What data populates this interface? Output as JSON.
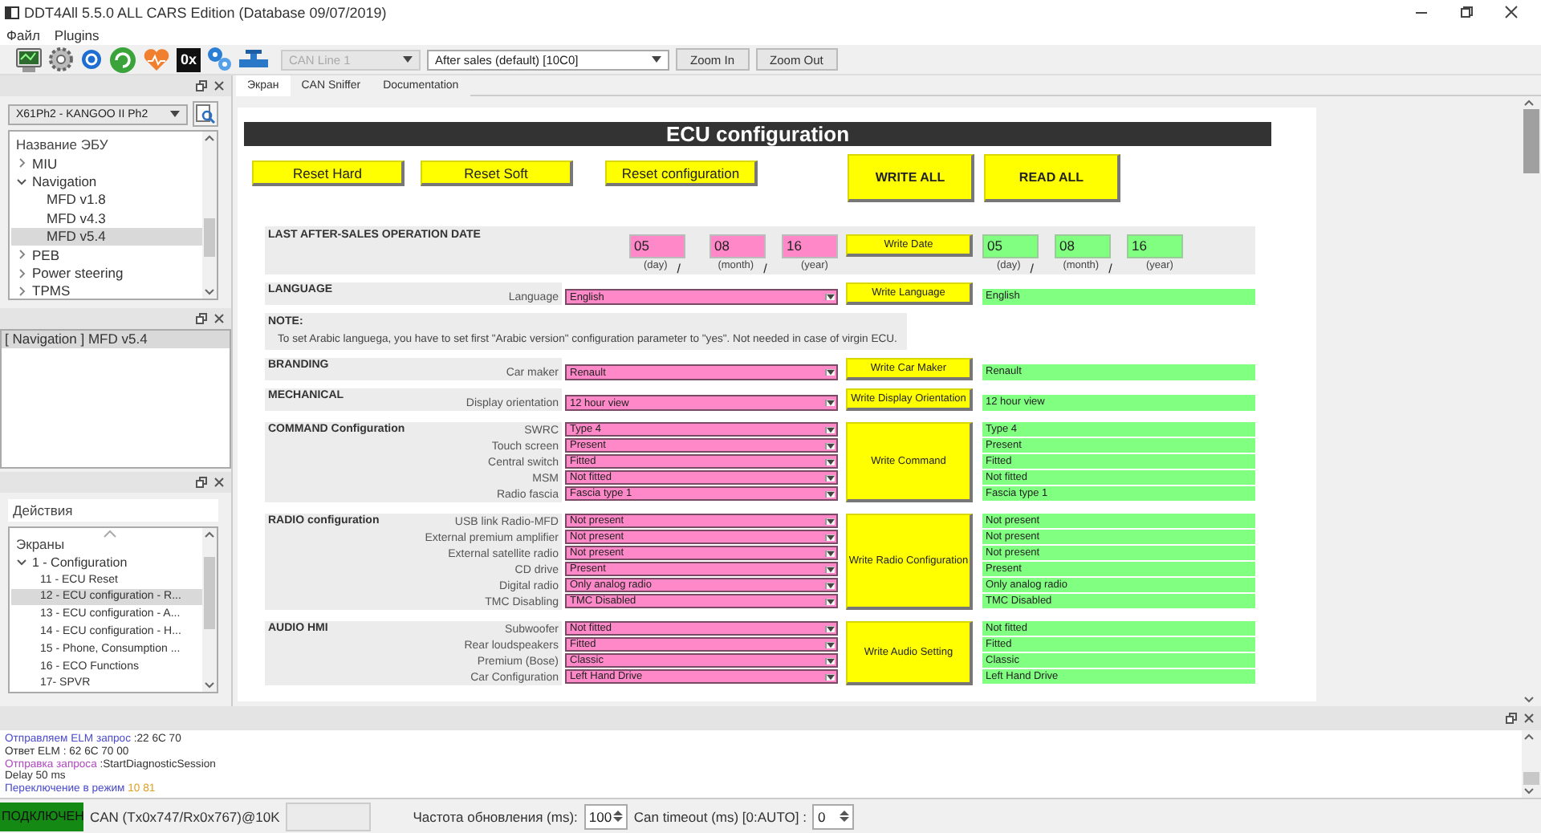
{
  "window": {
    "title": "DDT4All 5.5.0 ALL CARS Edition (Database 09/07/2019)"
  },
  "menu": [
    {
      "label": "Файл"
    },
    {
      "label": "Plugins"
    }
  ],
  "toolbar": {
    "hex_label": "0x",
    "combos": [
      {
        "value": "CAN Line 1",
        "disabled": true
      },
      {
        "value": "After sales (default) [10C0]",
        "disabled": false
      }
    ],
    "buttons": [
      "Zoom In",
      "Zoom Out"
    ]
  },
  "vehicle_select": {
    "value": "X61Ph2 - KANGOO II Ph2"
  },
  "ecu_tree": {
    "header": "Название ЭБУ",
    "items": [
      {
        "label": "MIU",
        "expanded": false,
        "selected": false
      },
      {
        "label": "Navigation",
        "expanded": true,
        "selected": false,
        "children": [
          {
            "label": "MFD v1.8",
            "selected": false
          },
          {
            "label": "MFD v4.3",
            "selected": false
          },
          {
            "label": "MFD v5.4",
            "selected": true
          }
        ]
      },
      {
        "label": "PEB",
        "expanded": false,
        "selected": false
      },
      {
        "label": "Power steering",
        "expanded": false,
        "selected": false
      },
      {
        "label": "TPMS",
        "expanded": false,
        "selected": false
      }
    ]
  },
  "ecu_list": [
    {
      "label": "[ Navigation ] MFD v5.4",
      "selected": true
    }
  ],
  "actions_field": {
    "value": "Действия"
  },
  "screens_tree": {
    "header": "Экраны",
    "items": [
      {
        "label": "1 - Configuration",
        "expanded": true,
        "selected": false,
        "children": [
          {
            "label": "11 - ECU Reset",
            "selected": false
          },
          {
            "label": "12 - ECU configuration - R...",
            "selected": true
          },
          {
            "label": "13 - ECU configuration - A...",
            "selected": false
          },
          {
            "label": "14 - ECU configuration - H...",
            "selected": false
          },
          {
            "label": "15 - Phone, Consumption ...",
            "selected": false
          },
          {
            "label": "16 - ECO Functions",
            "selected": false
          },
          {
            "label": "17- SPVR",
            "selected": false
          }
        ]
      }
    ]
  },
  "tabs": [
    {
      "label": "Экран",
      "selected": true
    },
    {
      "label": "CAN Sniffer",
      "selected": false
    },
    {
      "label": "Documentation",
      "selected": false
    }
  ],
  "screen": {
    "title": "ECU configuration",
    "buttons": [
      {
        "label": "Reset Hard",
        "kind": "small"
      },
      {
        "label": "Reset Soft",
        "kind": "small"
      },
      {
        "label": "Reset configuration",
        "kind": "small"
      },
      {
        "label": "WRITE ALL",
        "kind": "large"
      },
      {
        "label": "READ ALL",
        "kind": "large"
      }
    ],
    "date_section": {
      "title": "LAST AFTER-SALES OPERATION DATE",
      "button": "Write Date",
      "sent": [
        {
          "value": "05",
          "caption": "(day)",
          "separator": "/"
        },
        {
          "value": "08",
          "caption": "(month)",
          "separator": "/"
        },
        {
          "value": "16",
          "caption": "(year)"
        }
      ],
      "read": [
        {
          "value": "05",
          "caption": "(day)",
          "separator": "/"
        },
        {
          "value": "08",
          "caption": "(month)",
          "separator": "/"
        },
        {
          "value": "16",
          "caption": "(year)"
        }
      ]
    },
    "sections": [
      {
        "kind": "params",
        "title": "LANGUAGE",
        "button": "Write Language",
        "params": [
          {
            "label": "Language",
            "value": "English",
            "read": "English"
          }
        ]
      },
      {
        "kind": "note",
        "title": "NOTE:",
        "text": "To set Arabic languega, you have to set first \"Arabic version\" configuration parameter to \"yes\". Not needed in case of virgin ECU."
      },
      {
        "kind": "params",
        "title": "BRANDING",
        "button": "Write Car Maker",
        "params": [
          {
            "label": "Car maker",
            "value": "Renault",
            "read": "Renault"
          }
        ]
      },
      {
        "kind": "params",
        "title": "MECHANICAL",
        "button": "Write Display Orientation",
        "params": [
          {
            "label": "Display orientation",
            "value": "12 hour view",
            "read": "12 hour view"
          }
        ]
      },
      {
        "kind": "params",
        "title": "COMMAND Configuration",
        "button": "Write Command",
        "params": [
          {
            "label": "SWRC",
            "value": "Type 4",
            "read": "Type 4"
          },
          {
            "label": "Touch screen",
            "value": "Present",
            "read": "Present"
          },
          {
            "label": "Central switch",
            "value": "Fitted",
            "read": "Fitted"
          },
          {
            "label": "MSM",
            "value": "Not fitted",
            "read": "Not fitted"
          },
          {
            "label": "Radio fascia",
            "value": "Fascia type 1",
            "read": "Fascia type 1"
          }
        ]
      },
      {
        "kind": "params",
        "title": "RADIO configuration",
        "button": "Write Radio Configuration",
        "params": [
          {
            "label": "USB link Radio-MFD",
            "value": "Not present",
            "read": "Not present"
          },
          {
            "label": "External premium amplifier",
            "value": "Not present",
            "read": "Not present"
          },
          {
            "label": "External satellite radio",
            "value": "Not present",
            "read": "Not present"
          },
          {
            "label": "CD drive",
            "value": "Present",
            "read": "Present"
          },
          {
            "label": "Digital radio",
            "value": "Only analog radio",
            "read": "Only analog radio"
          },
          {
            "label": "TMC Disabling",
            "value": "TMC Disabled",
            "read": "TMC Disabled"
          }
        ]
      },
      {
        "kind": "params",
        "title": "AUDIO HMI",
        "button": "Write Audio Setting",
        "params": [
          {
            "label": "Subwoofer",
            "value": "Not fitted",
            "read": "Not fitted"
          },
          {
            "label": "Rear loudspeakers",
            "value": "Fitted",
            "read": "Fitted"
          },
          {
            "label": "Premium (Bose)",
            "value": "Classic",
            "read": "Classic"
          },
          {
            "label": "Car Configuration",
            "value": "Left Hand Drive",
            "read": "Left Hand Drive"
          }
        ]
      }
    ]
  },
  "log": [
    {
      "parts": [
        {
          "text": "Отправляем ELM запрос",
          "color": "#4b4bcc"
        },
        {
          "text": " :22 6C 70",
          "color": "#333333"
        }
      ]
    },
    {
      "parts": [
        {
          "text": "Ответ ELM : 62 6C 70 00",
          "color": "#333333"
        }
      ]
    },
    {
      "parts": [
        {
          "text": "Отправка запроса",
          "color": "#b048c0"
        },
        {
          "text": " :StartDiagnosticSession",
          "color": "#333333"
        }
      ]
    },
    {
      "parts": [
        {
          "text": "Delay 50 ms",
          "color": "#333333"
        }
      ]
    },
    {
      "parts": [
        {
          "text": "Переключение в режим",
          "color": "#4b4bcc"
        },
        {
          "text": " 10 81",
          "color": "#e0a020"
        }
      ]
    }
  ],
  "status": {
    "connection": "ПОДКЛЮЧЕН",
    "connected": true,
    "can_info": "CAN (Tx0x747/Rx0x767)@10K",
    "refresh_label": "Частота обновления (ms):",
    "refresh_value": "100",
    "timeout_label": "Can timeout (ms) [0:AUTO] :",
    "timeout_value": "0"
  }
}
